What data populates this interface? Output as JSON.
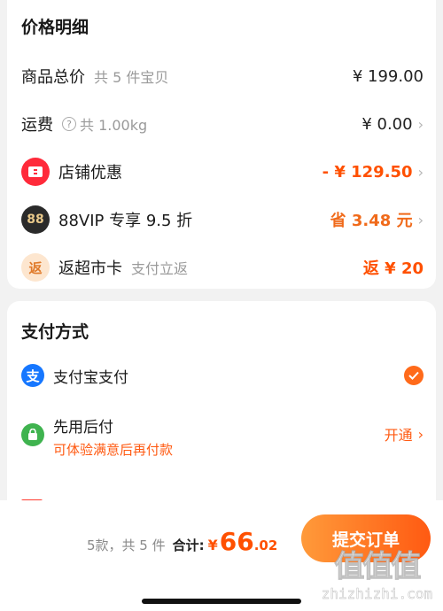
{
  "price_details": {
    "title": "价格明细",
    "items": [
      {
        "label": "商品总价",
        "sub": "共 5 件宝贝",
        "value": "¥ 199.00"
      },
      {
        "label": "运费",
        "sub": "共 1.00kg",
        "value": "¥ 0.00"
      },
      {
        "label": "店铺优惠",
        "value": "- ¥ 129.50"
      },
      {
        "label": "88VIP 专享 9.5 折",
        "badge": "88",
        "value": "省 3.48 元"
      },
      {
        "label": "返超市卡",
        "badge": "返",
        "sub": "支付立返",
        "value": "返 ¥ 20"
      }
    ]
  },
  "payment": {
    "title": "支付方式",
    "methods": [
      {
        "label": "支付宝支付",
        "icon": "alipay-icon",
        "selected": true
      },
      {
        "label": "先用后付",
        "sub": "可体验满意后再付款",
        "icon": "credit-later-icon",
        "action": "开通"
      }
    ]
  },
  "bottom": {
    "count": "5款，共 5 件",
    "total_label": "合计:",
    "currency": "¥",
    "total_int": "66",
    "total_dec": ".02",
    "submit": "提交订单"
  },
  "watermark": {
    "glyphs": "值值值",
    "text": "zhizhizhi.com"
  },
  "colors": {
    "accent": "#ff5000",
    "alipay": "#1677ff",
    "green": "#3fb34f",
    "coupon_red": "#ff2a3a"
  }
}
